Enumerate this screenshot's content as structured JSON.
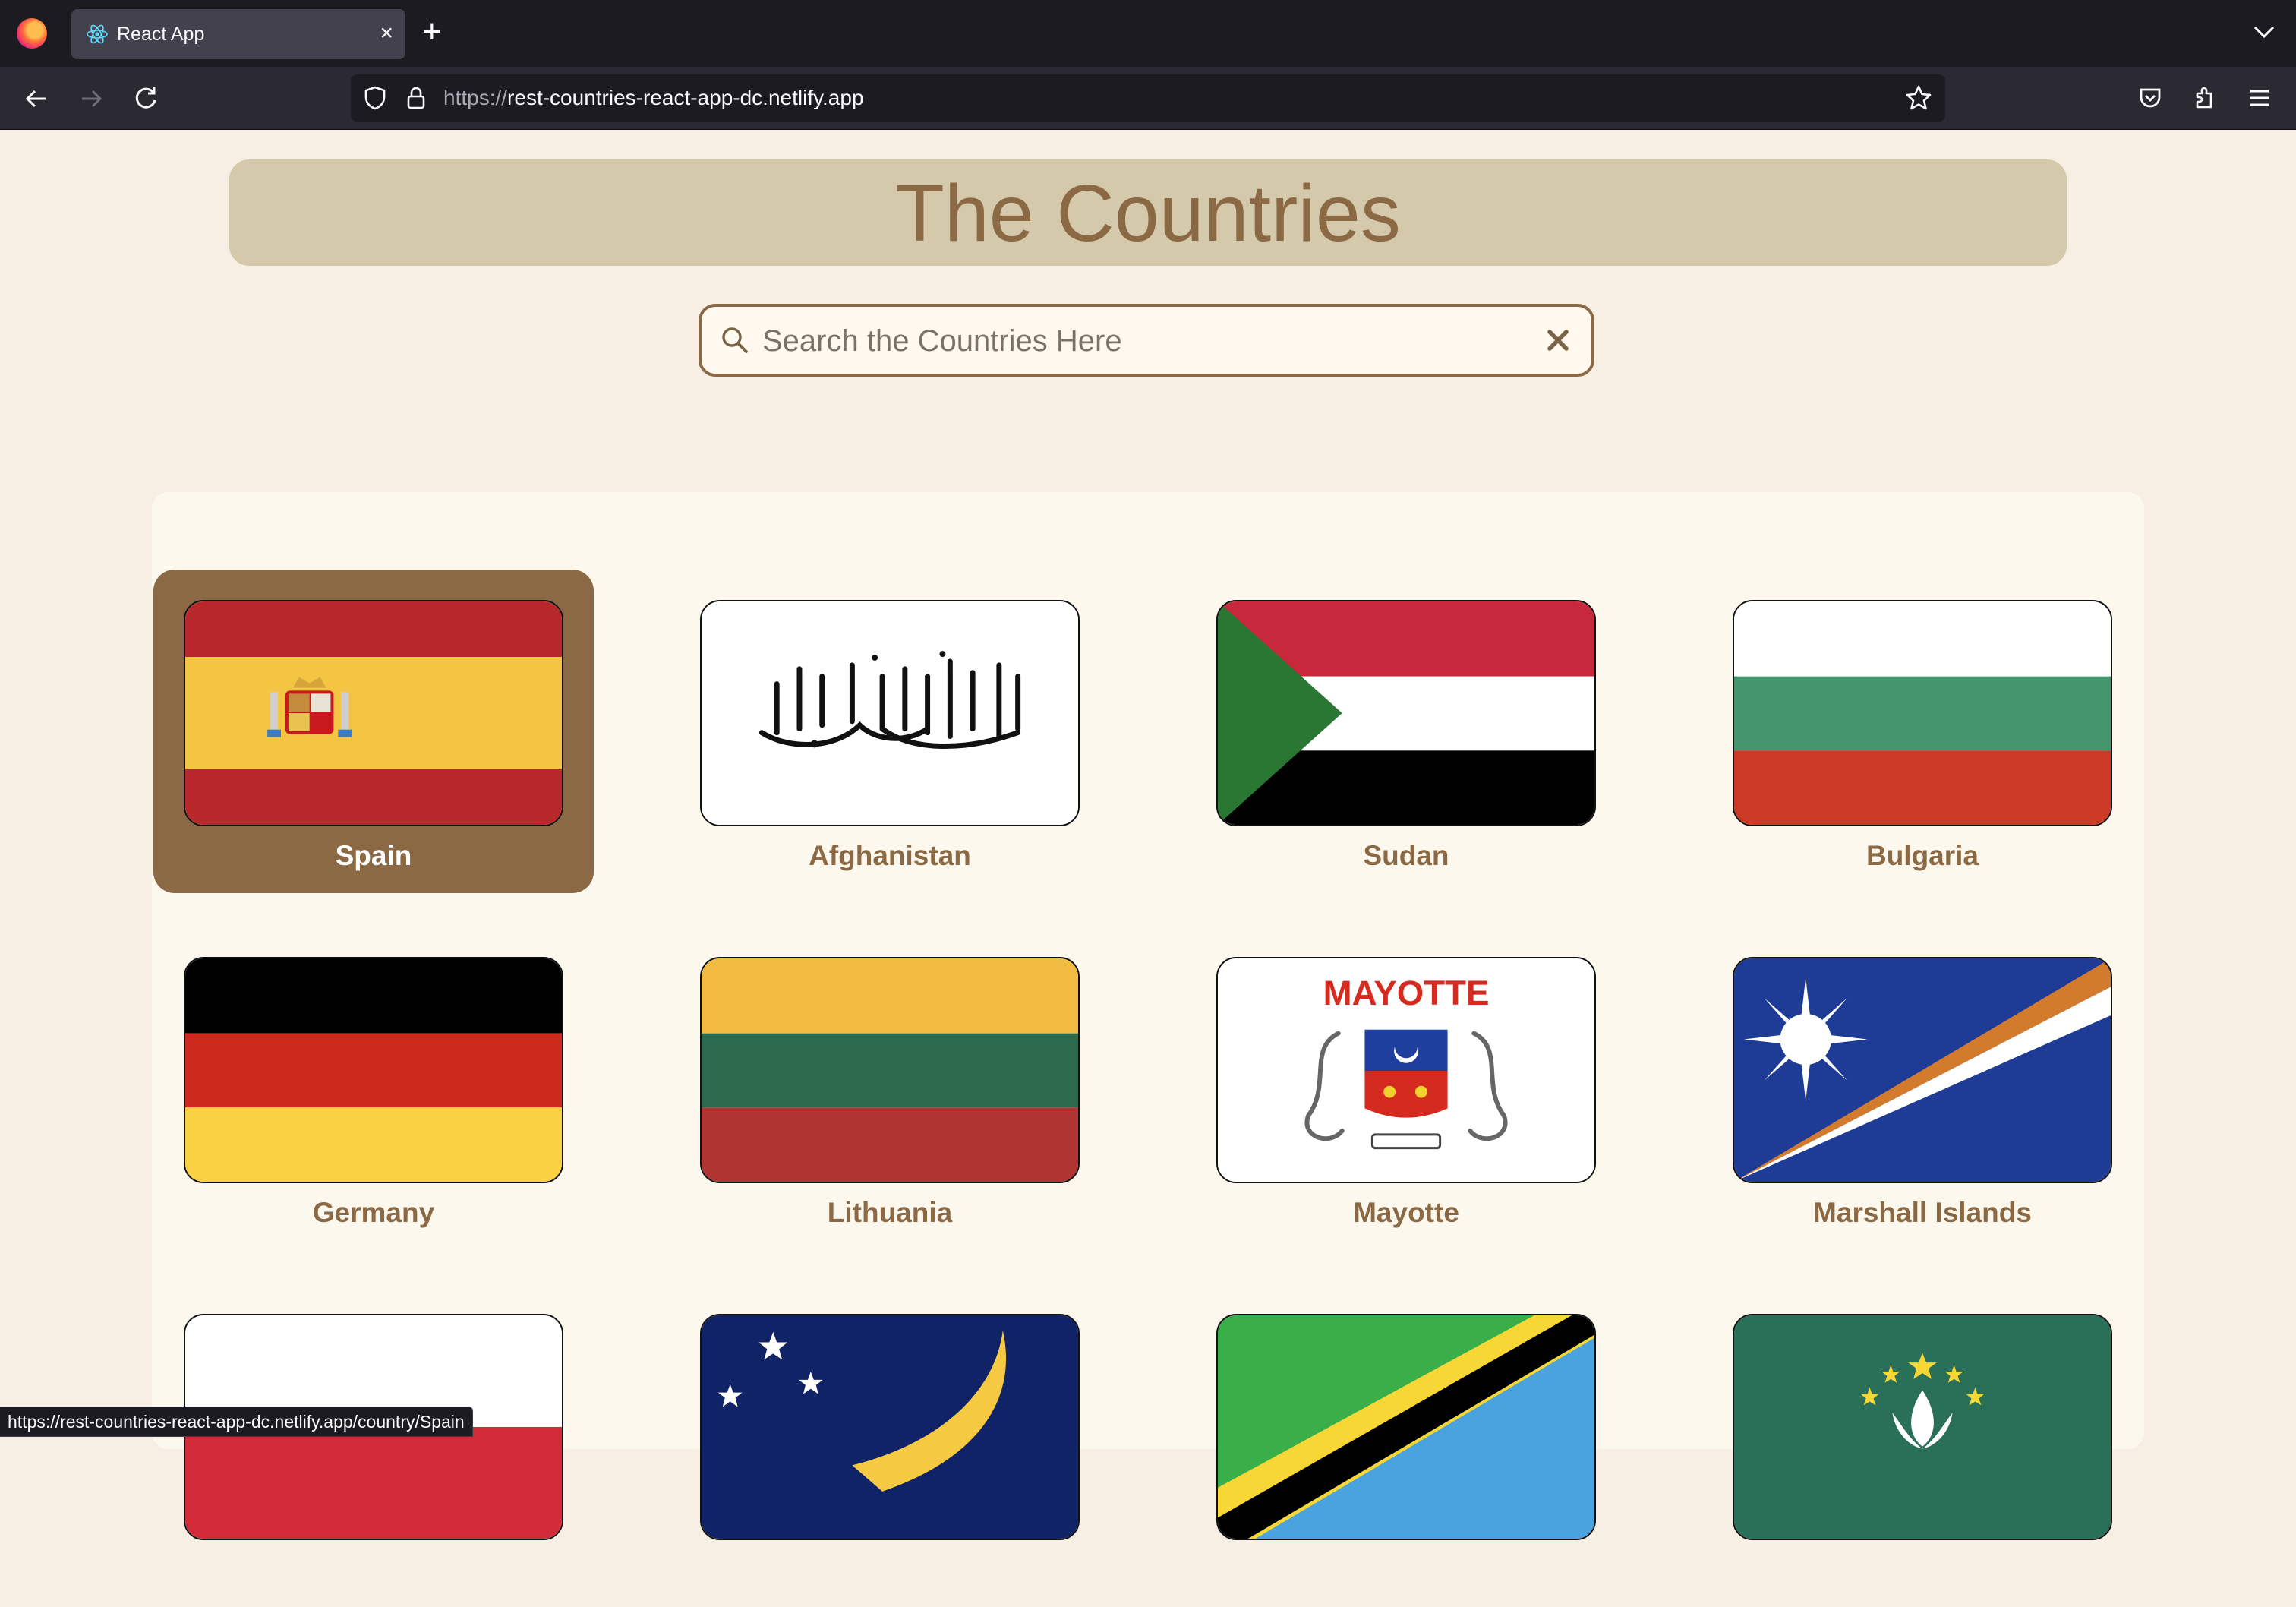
{
  "browser": {
    "tab_title": "React App",
    "url_scheme": "https://",
    "url_host": "rest-countries-react-app-dc.netlify.app",
    "status_url": "https://rest-countries-react-app-dc.netlify.app/country/Spain"
  },
  "page": {
    "title": "The Countries",
    "search_placeholder": "Search the Countries Here",
    "search_value": ""
  },
  "countries": [
    {
      "name": "Spain",
      "flag": "spain-flag",
      "selected": true
    },
    {
      "name": "Afghanistan",
      "flag": "afghanistan-flag"
    },
    {
      "name": "Sudan",
      "flag": "sudan-flag"
    },
    {
      "name": "Bulgaria",
      "flag": "bulgaria-flag"
    },
    {
      "name": "Germany",
      "flag": "germany-flag"
    },
    {
      "name": "Lithuania",
      "flag": "lithuania-flag"
    },
    {
      "name": "Mayotte",
      "flag": "mayotte-flag",
      "flag_text": "MAYOTTE"
    },
    {
      "name": "Marshall Islands",
      "flag": "marshall-islands-flag"
    },
    {
      "name": "",
      "flag": "partial-white-red-flag"
    },
    {
      "name": "",
      "flag": "tokelau-flag"
    },
    {
      "name": "",
      "flag": "tanzania-flag"
    },
    {
      "name": "",
      "flag": "macau-flag"
    }
  ],
  "colors": {
    "accent": "#8b6945",
    "header_bg": "#d5c9ab",
    "page_bg": "#f7efe3",
    "grid_bg": "#fdf8ee"
  }
}
